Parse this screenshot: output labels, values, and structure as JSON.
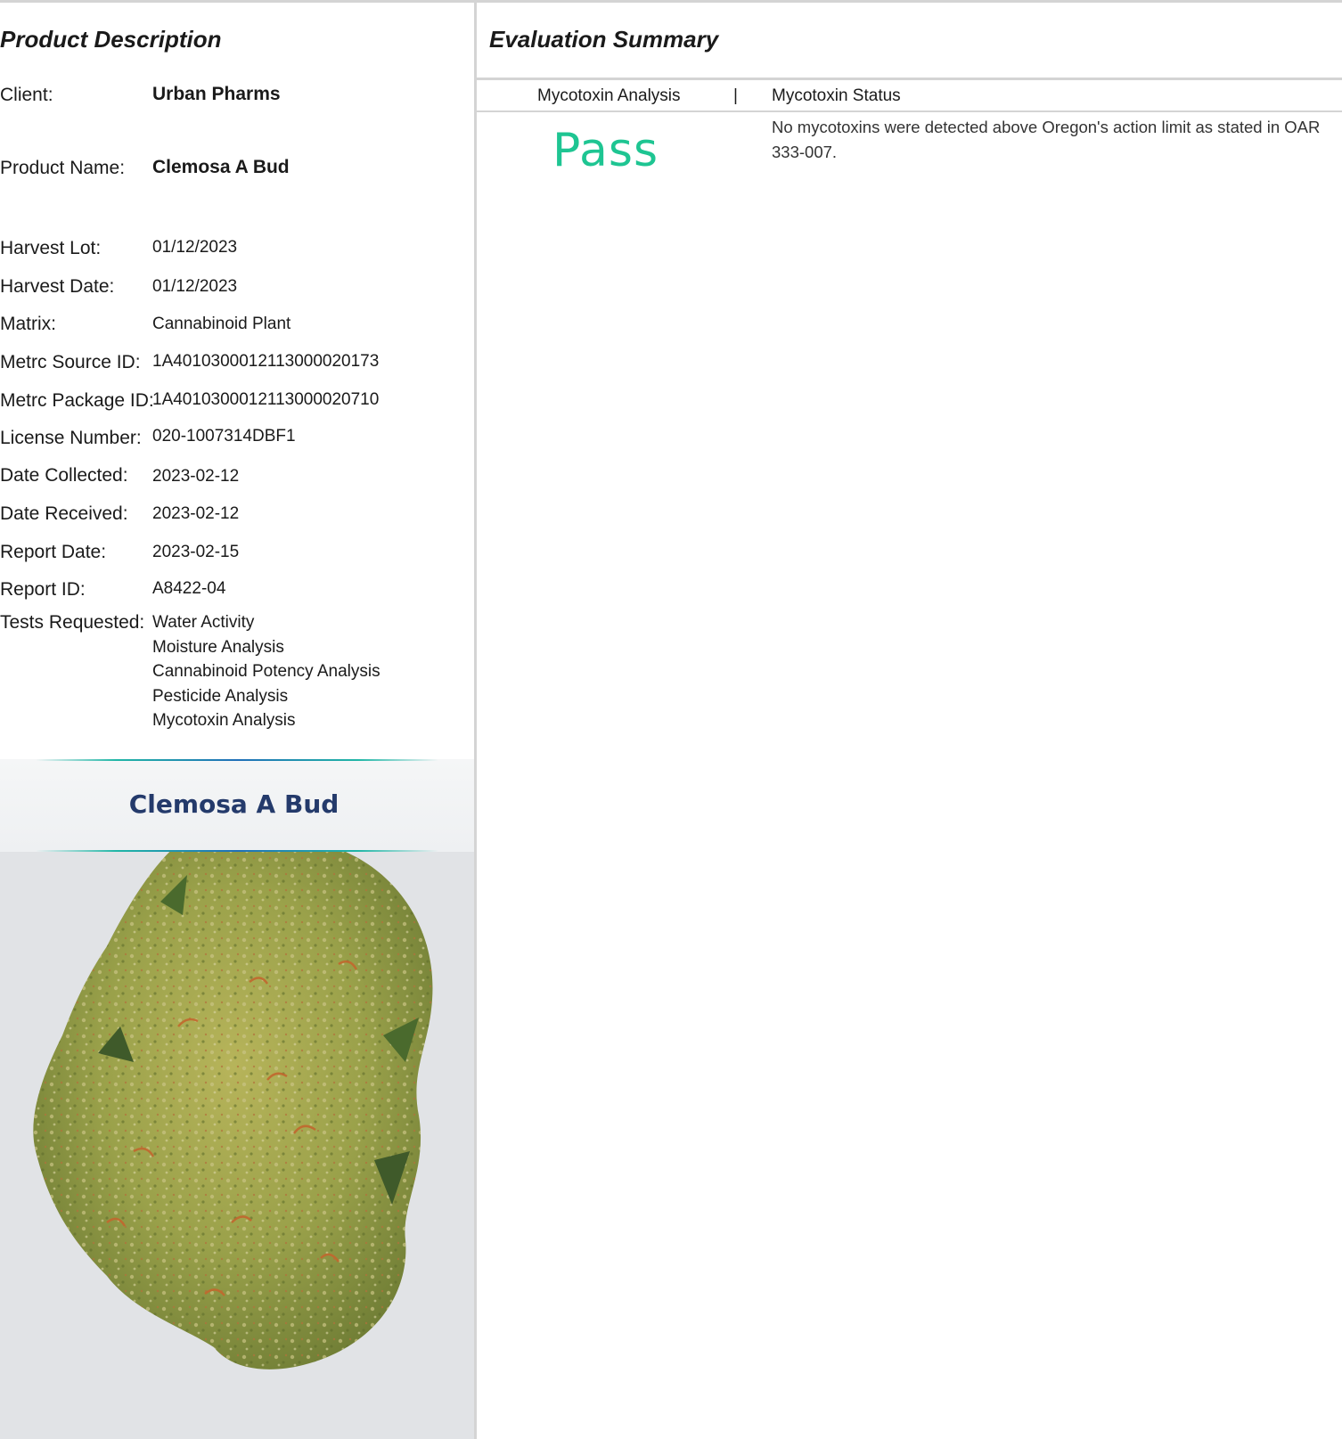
{
  "product_description": {
    "title": "Product Description",
    "client_label": "Client:",
    "client_value": "Urban Pharms",
    "product_name_label": "Product Name:",
    "product_name_value": "Clemosa A Bud",
    "fields": [
      {
        "label": "Harvest Lot:",
        "value": "01/12/2023"
      },
      {
        "label": "Harvest Date:",
        "value": "01/12/2023"
      },
      {
        "label": "Matrix:",
        "value": "Cannabinoid Plant"
      },
      {
        "label": "Metrc Source ID:",
        "value": "1A4010300012113000020173"
      },
      {
        "label": "Metrc Package ID:",
        "value": "1A4010300012113000020710"
      },
      {
        "label": "License Number:",
        "value": "020-1007314DBF1"
      },
      {
        "label": "Date Collected:",
        "value": "2023-02-12"
      },
      {
        "label": "Date Received:",
        "value": "2023-02-12"
      },
      {
        "label": "Report Date:",
        "value": "2023-02-15"
      },
      {
        "label": "Report ID:",
        "value": "A8422-04"
      }
    ],
    "tests_label": "Tests Requested:",
    "tests": [
      "Water Activity",
      "Moisture Analysis",
      "Cannabinoid Potency Analysis",
      "Pesticide Analysis",
      "Mycotoxin Analysis"
    ],
    "image_banner_title": "Clemosa A Bud"
  },
  "evaluation_summary": {
    "title": "Evaluation Summary",
    "col_analysis": "Mycotoxin Analysis",
    "separator": "|",
    "col_status": "Mycotoxin Status",
    "result": "Pass",
    "status_text": "No mycotoxins were detected above Oregon's action limit as stated in OAR 333-007.",
    "result_color": "#1ec592"
  },
  "colors": {
    "divider": "#d4d4d4",
    "banner_title": "#243a6b",
    "bud_green": "#9aa64a",
    "background_photo": "#e1e3e6"
  }
}
